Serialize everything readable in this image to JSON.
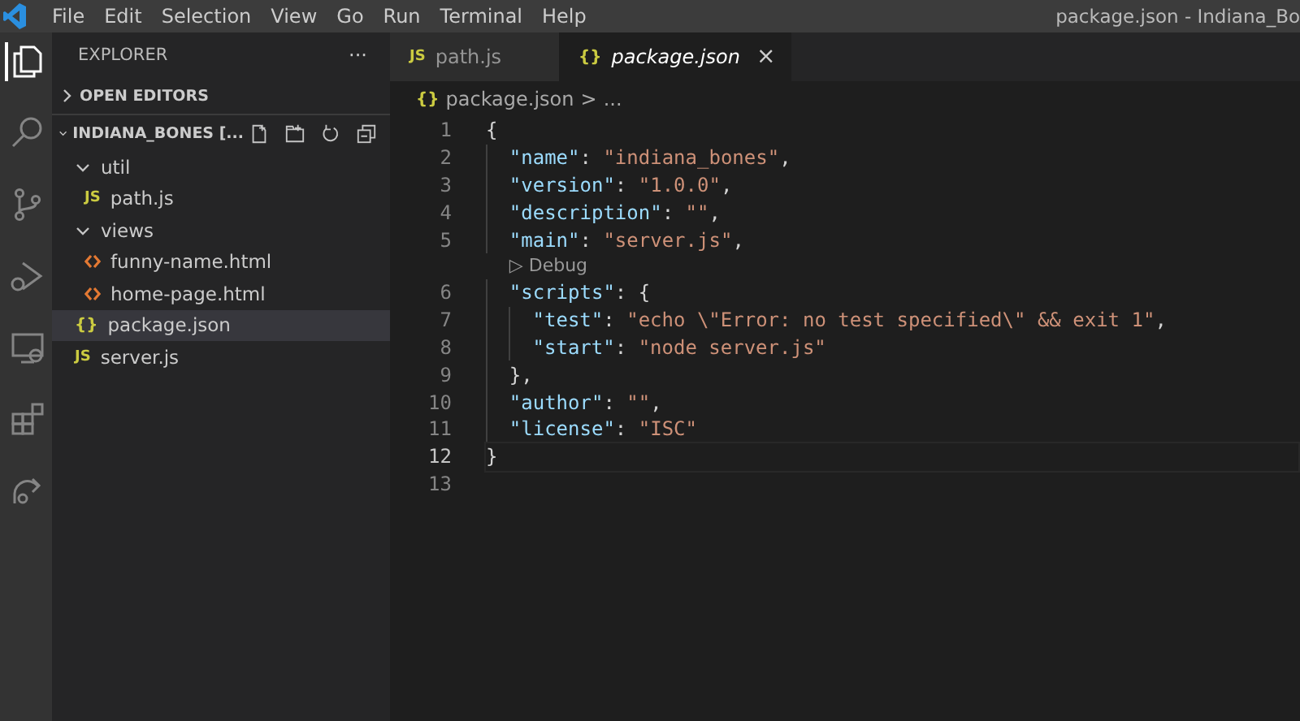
{
  "menu": [
    "File",
    "Edit",
    "Selection",
    "View",
    "Go",
    "Run",
    "Terminal",
    "Help"
  ],
  "window": {
    "title": "package.json - Indiana_Bo"
  },
  "activity_bar": [
    {
      "kind": "files",
      "selected": true
    },
    {
      "kind": "search",
      "selected": false
    },
    {
      "kind": "source-control",
      "selected": false
    },
    {
      "kind": "run",
      "selected": false
    },
    {
      "kind": "remote",
      "selected": false
    },
    {
      "kind": "extensions",
      "selected": false
    },
    {
      "kind": "share",
      "selected": false
    }
  ],
  "sidebar": {
    "title": "EXPLORER",
    "more": "···",
    "sections": [
      {
        "label": "OPEN EDITORS",
        "expanded": false,
        "toolbar": false
      },
      {
        "label": "INDIANA_BONES [...",
        "expanded": true,
        "toolbar": true
      }
    ],
    "tree": [
      {
        "kind": "folder",
        "label": "util",
        "expanded": true,
        "selected": false,
        "children": [
          {
            "kind": "js",
            "icon": "JS",
            "label": "path.js",
            "selected": false
          }
        ]
      },
      {
        "kind": "folder",
        "label": "views",
        "expanded": true,
        "selected": false,
        "children": [
          {
            "kind": "html",
            "label": "funny-name.html",
            "selected": false
          },
          {
            "kind": "html",
            "label": "home-page.html",
            "selected": false
          }
        ]
      },
      {
        "kind": "json",
        "icon": "{}",
        "label": "package.json",
        "selected": true
      },
      {
        "kind": "js",
        "icon": "JS",
        "label": "server.js",
        "selected": false
      }
    ]
  },
  "tabs": [
    {
      "kind": "js",
      "icon": "JS",
      "label": "path.js",
      "selected": false
    },
    {
      "kind": "json",
      "icon": "{}",
      "label": "package.json",
      "selected": true,
      "close": "×"
    }
  ],
  "breadcrumb": {
    "icon": "{}",
    "file": "package.json",
    "separator": ">",
    "rest": "..."
  },
  "code": [
    {
      "kind": "code",
      "number": "1",
      "current": false,
      "tokens": [
        {
          "kind": "punct",
          "text": "{"
        }
      ],
      "children": [
        {
          "kind": "code",
          "number": "2",
          "current": false,
          "tokens": [
            {
              "kind": "key",
              "text": "\"name\""
            },
            {
              "kind": "punct",
              "text": ": "
            },
            {
              "kind": "string",
              "text": "\"indiana_bones\""
            },
            {
              "kind": "punct",
              "text": ","
            }
          ]
        },
        {
          "kind": "code",
          "number": "3",
          "current": false,
          "tokens": [
            {
              "kind": "key",
              "text": "\"version\""
            },
            {
              "kind": "punct",
              "text": ": "
            },
            {
              "kind": "string",
              "text": "\"1.0.0\""
            },
            {
              "kind": "punct",
              "text": ","
            }
          ]
        },
        {
          "kind": "code",
          "number": "4",
          "current": false,
          "tokens": [
            {
              "kind": "key",
              "text": "\"description\""
            },
            {
              "kind": "punct",
              "text": ": "
            },
            {
              "kind": "string",
              "text": "\"\""
            },
            {
              "kind": "punct",
              "text": ","
            }
          ]
        },
        {
          "kind": "code",
          "number": "5",
          "current": false,
          "tokens": [
            {
              "kind": "key",
              "text": "\"main\""
            },
            {
              "kind": "punct",
              "text": ": "
            },
            {
              "kind": "string",
              "text": "\"server.js\""
            },
            {
              "kind": "punct",
              "text": ","
            }
          ]
        },
        {
          "kind": "codelens",
          "icon": "▷",
          "text": "Debug"
        },
        {
          "kind": "code",
          "number": "6",
          "current": false,
          "tokens": [
            {
              "kind": "key",
              "text": "\"scripts\""
            },
            {
              "kind": "punct",
              "text": ": {"
            }
          ],
          "children": [
            {
              "kind": "code",
              "number": "7",
              "current": false,
              "tokens": [
                {
                  "kind": "key",
                  "text": "\"test\""
                },
                {
                  "kind": "punct",
                  "text": ": "
                },
                {
                  "kind": "string",
                  "text": "\"echo \\\"Error: no test specified\\\" && exit 1\""
                },
                {
                  "kind": "punct",
                  "text": ","
                }
              ]
            },
            {
              "kind": "code",
              "number": "8",
              "current": false,
              "tokens": [
                {
                  "kind": "key",
                  "text": "\"start\""
                },
                {
                  "kind": "punct",
                  "text": ": "
                },
                {
                  "kind": "string",
                  "text": "\"node server.js\""
                }
              ]
            }
          ]
        },
        {
          "kind": "code",
          "number": "9",
          "current": false,
          "tokens": [
            {
              "kind": "punct",
              "text": "},"
            }
          ]
        },
        {
          "kind": "code",
          "number": "10",
          "current": false,
          "tokens": [
            {
              "kind": "key",
              "text": "\"author\""
            },
            {
              "kind": "punct",
              "text": ": "
            },
            {
              "kind": "string",
              "text": "\"\""
            },
            {
              "kind": "punct",
              "text": ","
            }
          ]
        },
        {
          "kind": "code",
          "number": "11",
          "current": false,
          "tokens": [
            {
              "kind": "key",
              "text": "\"license\""
            },
            {
              "kind": "punct",
              "text": ": "
            },
            {
              "kind": "string",
              "text": "\"ISC\""
            }
          ]
        }
      ]
    },
    {
      "kind": "code",
      "number": "12",
      "current": true,
      "tokens": [
        {
          "kind": "punct",
          "text": "}"
        }
      ]
    },
    {
      "kind": "code",
      "number": "13",
      "current": false
    }
  ]
}
